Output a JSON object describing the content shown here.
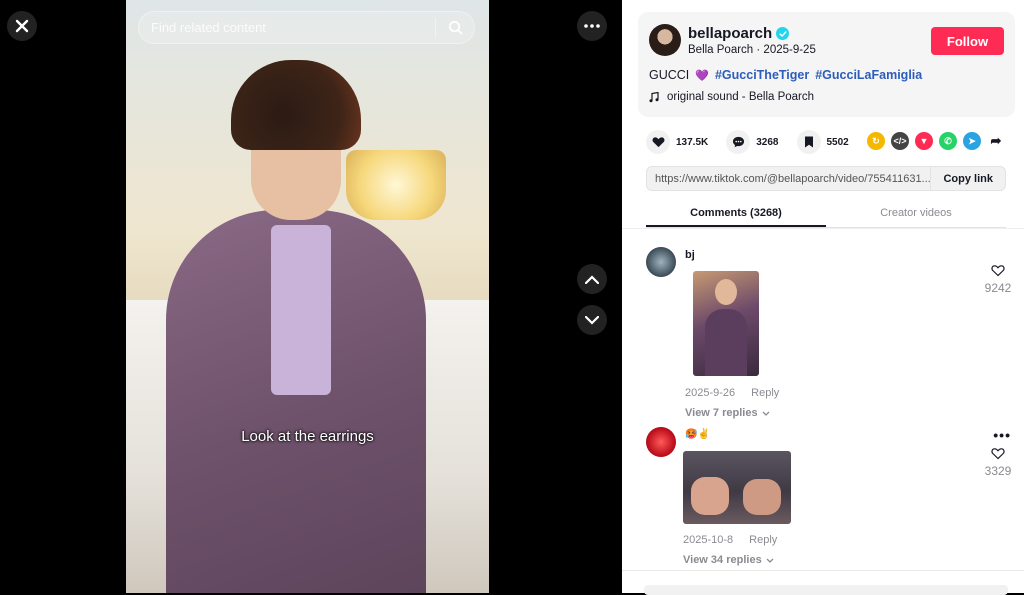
{
  "search": {
    "placeholder": "Find related content"
  },
  "video": {
    "caption": "Look at the earrings"
  },
  "post": {
    "username": "bellapoarch",
    "display_name": "Bella Poarch",
    "date": "2025-9-25",
    "subline": "Bella Poarch · 2025-9-25",
    "follow_label": "Follow",
    "description_text": "GUCCI",
    "emoji": "💜",
    "hashtags": [
      "#GucciTheTiger",
      "#GucciLaFamiglia"
    ],
    "sound": "original sound - Bella Poarch"
  },
  "stats": {
    "likes": "137.5K",
    "comments": "3268",
    "saves": "5502"
  },
  "share_icons": [
    "repost-icon",
    "embed-icon",
    "send-icon",
    "whatsapp-icon",
    "telegram-icon",
    "share-arrow-icon"
  ],
  "link": {
    "url": "https://www.tiktok.com/@bellapoarch/video/755411631...",
    "copy_label": "Copy link"
  },
  "tabs": [
    {
      "label": "Comments (3268)"
    },
    {
      "label": "Creator videos"
    }
  ],
  "comments": [
    {
      "author": "bj",
      "date": "2025-9-26",
      "reply_label": "Reply",
      "replies_label": "View 7 replies",
      "likes": "9242"
    },
    {
      "author": "🥵✌️",
      "date": "2025-10-8",
      "reply_label": "Reply",
      "replies_label": "View 34 replies",
      "likes": "3329"
    }
  ],
  "colors": {
    "accent": "#fe2c55",
    "hashtag": "#2b5db9",
    "verified": "#20d5ec"
  }
}
